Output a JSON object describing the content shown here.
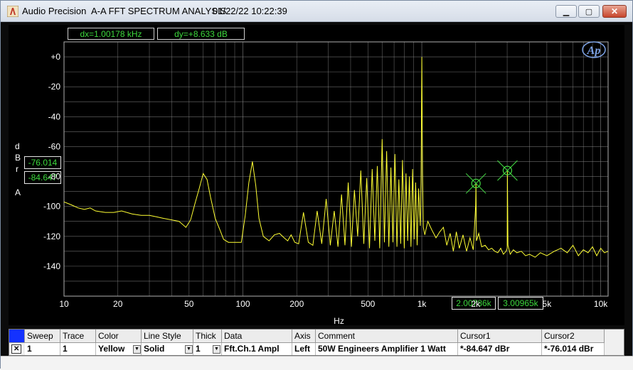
{
  "window": {
    "app_name": "Audio Precision",
    "title": "A-A FFT SPECTRUM ANALYSIS",
    "timestamp": "01/22/22 10:22:39",
    "minimize_glyph": "▁",
    "maximize_glyph": "▢",
    "close_glyph": "✕"
  },
  "readouts": {
    "dx": "dx=1.00178 kHz",
    "dy": "dy=+8.633  dB"
  },
  "cursor_readouts": {
    "y1": "-76.014",
    "y2": "-84.647",
    "x1": "2.00786k",
    "x2": "3.00965k"
  },
  "y_unit_letters": [
    "d",
    "B",
    "r",
    "A"
  ],
  "logo_text": "Ap",
  "chart_data": {
    "type": "line",
    "title": "",
    "xlabel": "Hz",
    "ylabel": "dBr A",
    "x_scale": "log",
    "xlim": [
      10,
      11000
    ],
    "ylim": [
      -160,
      10
    ],
    "x_ticks": [
      10,
      20,
      50,
      100,
      200,
      500,
      1000,
      2000,
      5000,
      10000
    ],
    "x_tick_labels": [
      "10",
      "20",
      "50",
      "100",
      "200",
      "500",
      "1k",
      "2k",
      "5k",
      "10k"
    ],
    "y_ticks": [
      0,
      -20,
      -40,
      -60,
      -80,
      -100,
      -120,
      -140
    ],
    "y_tick_labels": [
      "+0",
      "-20",
      "-40",
      "-60",
      "-80",
      "-100",
      "-120",
      "-140"
    ],
    "grid": true,
    "colors": {
      "background": "#000000",
      "grid": "#8a8a8a",
      "trace": "#ffff33",
      "cursor": "#44dd44"
    },
    "series": [
      {
        "name": "Fft.Ch.1 Ampl",
        "x": [
          10,
          11,
          12,
          13,
          14,
          15,
          17,
          19,
          21,
          24,
          27,
          30,
          33,
          36,
          40,
          44,
          48,
          51,
          54,
          57,
          60,
          63,
          66,
          70,
          74,
          78,
          83,
          88,
          93,
          98,
          103,
          108,
          113,
          118,
          123,
          130,
          140,
          150,
          160,
          170,
          178,
          186,
          195,
          205,
          218,
          232,
          246,
          260,
          276,
          292,
          308,
          324,
          340,
          356,
          372,
          388,
          404,
          420,
          438,
          456,
          474,
          492,
          510,
          528,
          546,
          564,
          582,
          600,
          618,
          636,
          654,
          672,
          690,
          708,
          726,
          744,
          762,
          780,
          798,
          816,
          834,
          852,
          870,
          888,
          906,
          924,
          942,
          960,
          980,
          990,
          1000,
          1010,
          1020,
          1040,
          1080,
          1140,
          1200,
          1260,
          1320,
          1380,
          1440,
          1500,
          1560,
          1620,
          1700,
          1780,
          1860,
          1940,
          2000,
          2008,
          2020,
          2080,
          2160,
          2260,
          2360,
          2460,
          2560,
          2660,
          2760,
          2860,
          2960,
          3000,
          3010,
          3030,
          3120,
          3250,
          3400,
          3600,
          3800,
          4000,
          4300,
          4600,
          5000,
          5500,
          6000,
          6500,
          7000,
          7500,
          8000,
          8500,
          9000,
          9500,
          10000,
          10500,
          11000
        ],
        "y": [
          -97,
          -99,
          -101,
          -102,
          -101,
          -103,
          -104,
          -104,
          -103,
          -105,
          -106,
          -106,
          -107,
          -108,
          -109,
          -110,
          -114,
          -109,
          -98,
          -88,
          -78,
          -82,
          -94,
          -108,
          -115,
          -122,
          -124,
          -124,
          -124,
          -124,
          -106,
          -84,
          -70,
          -86,
          -108,
          -120,
          -123,
          -119,
          -118,
          -121,
          -123,
          -119,
          -124,
          -125,
          -104,
          -124,
          -126,
          -103,
          -125,
          -95,
          -126,
          -103,
          -127,
          -92,
          -126,
          -84,
          -127,
          -89,
          -120,
          -76,
          -125,
          -81,
          -128,
          -75,
          -123,
          -73,
          -128,
          -55,
          -124,
          -63,
          -127,
          -74,
          -124,
          -65,
          -127,
          -82,
          -125,
          -69,
          -128,
          -78,
          -123,
          -80,
          -127,
          -75,
          -122,
          -84,
          -126,
          -88,
          -113,
          -84,
          0,
          -78,
          -114,
          -119,
          -110,
          -116,
          -121,
          -117,
          -114,
          -126,
          -118,
          -130,
          -117,
          -128,
          -119,
          -130,
          -121,
          -129,
          -99,
          -84.647,
          -123,
          -118,
          -127,
          -126,
          -129,
          -128,
          -130,
          -131,
          -128,
          -132,
          -130,
          -128,
          -76.014,
          -126,
          -132,
          -129,
          -131,
          -130,
          -133,
          -132,
          -134,
          -131,
          -133,
          -130,
          -128,
          -131,
          -126,
          -133,
          -129,
          -131,
          -127,
          -133,
          -128,
          -131,
          -130
        ]
      }
    ],
    "cursors": [
      {
        "name": "Cursor1",
        "x": 2007.86,
        "y": -84.647
      },
      {
        "name": "Cursor2",
        "x": 3009.65,
        "y": -76.014
      }
    ]
  },
  "table": {
    "headers": [
      "Sweep",
      "Trace",
      "Color",
      "Line Style",
      "Thick",
      "Data",
      "Axis",
      "Comment",
      "Cursor1",
      "Cursor2"
    ],
    "row": {
      "checkbox": "✕",
      "sweep": "1",
      "trace": "1",
      "color": "Yellow",
      "line_style": "Solid",
      "thick": "1",
      "data": "Fft.Ch.1 Ampl",
      "axis": "Left",
      "comment": "50W Engineers Amplifier 1 Watt",
      "cursor1": "*-84.647  dBr",
      "cursor2": "*-76.014  dBr"
    }
  }
}
